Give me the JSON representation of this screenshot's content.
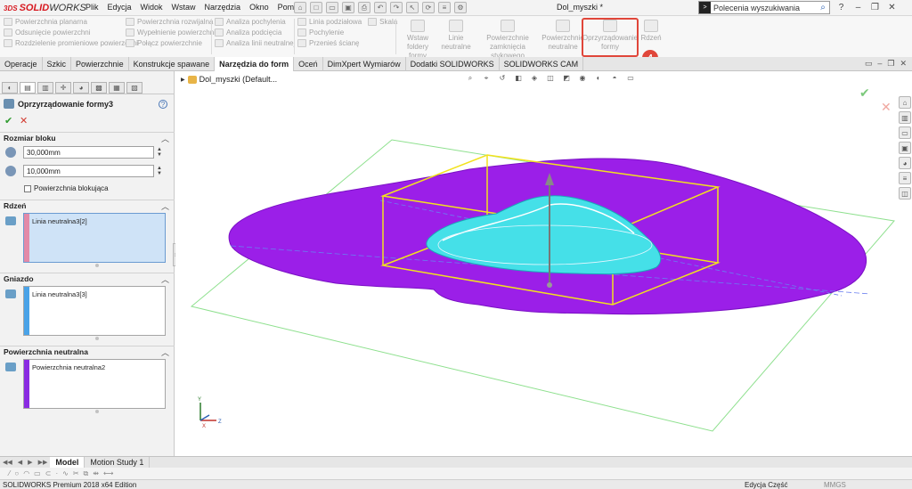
{
  "app": {
    "logo_brand": "3DS",
    "logo_solid": "SOLID",
    "logo_works": "WORKS",
    "document_title": "Dol_myszki *"
  },
  "menu": [
    "Plik",
    "Edycja",
    "Widok",
    "Wstaw",
    "Narzędzia",
    "Okno",
    "Pomoc"
  ],
  "search": {
    "placeholder": "Polecenia wyszukiwania"
  },
  "command_manager": {
    "col1": [
      "Powierzchnia planarna",
      "Odsunięcie powierzchni",
      "Rozdzielenie promieniowe powierzchni"
    ],
    "col2": [
      "Powierzchnia rozwijalna",
      "Wypełnienie powierzchni",
      "Połącz powierzchnie"
    ],
    "col3": [
      "Analiza pochylenia",
      "Analiza podcięcia",
      "Analiza linii neutralnej"
    ],
    "col4": [
      "Linia podziałowa",
      "Pochylenie",
      "Przenieś ścianę"
    ],
    "col4_scale": "Skala",
    "big": [
      {
        "line1": "Wstaw",
        "line2": "foldery formy"
      },
      {
        "line1": "Linie",
        "line2": "neutralne"
      },
      {
        "line1": "Powierzchnie",
        "line2": "zamknięcia stykowego"
      },
      {
        "line1": "Powierzchnie",
        "line2": "neutralne"
      },
      {
        "line1": "Oprzyrządowanie",
        "line2": "formy"
      },
      {
        "line1": "Rdzeń",
        "line2": ""
      }
    ],
    "step_badge": "4",
    "highlight_color": "#e0463a"
  },
  "tabs": [
    "Operacje",
    "Szkic",
    "Powierzchnie",
    "Konstrukcje spawane",
    "Narzędzia do form",
    "Oceń",
    "DimXpert Wymiarów",
    "Dodatki SOLIDWORKS",
    "SOLIDWORKS CAM"
  ],
  "active_tab": "Narzędzia do form",
  "panel": {
    "title": "Oprzyrządowanie formy3",
    "ok": "✔",
    "cancel": "✕",
    "block_size": {
      "header": "Rozmiar bloku",
      "value1": "30,000mm",
      "value2": "10,000mm",
      "checkbox_label": "Powierzchnia blokująca"
    },
    "core": {
      "header": "Rdzeń",
      "item": "Linia neutralna3[2]",
      "color": "#e38aa8"
    },
    "cavity": {
      "header": "Gniazdo",
      "item": "Linia neutralna3[3]",
      "color": "#4aa3e8"
    },
    "parting": {
      "header": "Powierzchnia neutralna",
      "item": "Powierzchnia neutralna2",
      "color": "#8a2be2"
    }
  },
  "viewport": {
    "tree_path": "Dol_myszki  (Default...",
    "surface_color": "#9b1fe8",
    "core_color": "#45e0e8",
    "block_color": "#f2e21d",
    "plane_color": "#8ee08e"
  },
  "bottom_tabs": [
    "Model",
    "Motion Study 1"
  ],
  "status": {
    "edition": "SOLIDWORKS Premium 2018 x64 Edition",
    "editing": "Edycja Część",
    "units": "MMGS"
  }
}
